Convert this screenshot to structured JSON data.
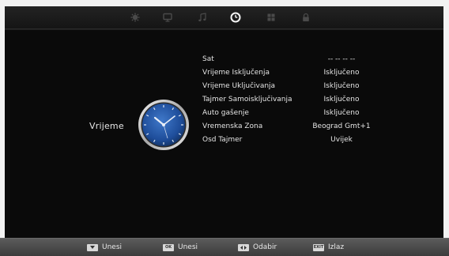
{
  "tabs": [
    {
      "icon": "picture-icon",
      "active": false
    },
    {
      "icon": "monitor-icon",
      "active": false
    },
    {
      "icon": "music-note-icon",
      "active": false
    },
    {
      "icon": "clock-icon",
      "active": true
    },
    {
      "icon": "grid-icon",
      "active": false
    },
    {
      "icon": "lock-icon",
      "active": false
    }
  ],
  "section": {
    "title": "Vrijeme",
    "icon": "clock-illustration-icon"
  },
  "menu": [
    {
      "label": "Sat",
      "value": "-- --    -- --"
    },
    {
      "label": "Vrijeme Isključenja",
      "value": "Isključeno"
    },
    {
      "label": "Vrijeme Uključivanja",
      "value": "Isključeno"
    },
    {
      "label": "Tajmer Samoisključivanja",
      "value": "Isključeno"
    },
    {
      "label": "Auto gašenje",
      "value": "Isključeno"
    },
    {
      "label": "Vremenska Zona",
      "value": "Beograd Gmt+1"
    },
    {
      "label": "Osd Tajmer",
      "value": "Uvijek"
    }
  ],
  "footer": [
    {
      "key_icon": "down-arrow-key-icon",
      "key_text": "",
      "label": "Unesi"
    },
    {
      "key_icon": "ok-key-icon",
      "key_text": "OK",
      "label": "Unesi"
    },
    {
      "key_icon": "left-right-key-icon",
      "key_text": "",
      "label": "Odabir"
    },
    {
      "key_icon": "exit-key-icon",
      "key_text": "EXIT",
      "label": "Izlaz"
    }
  ],
  "colors": {
    "background": "#0a0a0a",
    "footer": "#4a4a4a",
    "text": "#e4e4e4",
    "clock_face": "#1f4f9c"
  }
}
